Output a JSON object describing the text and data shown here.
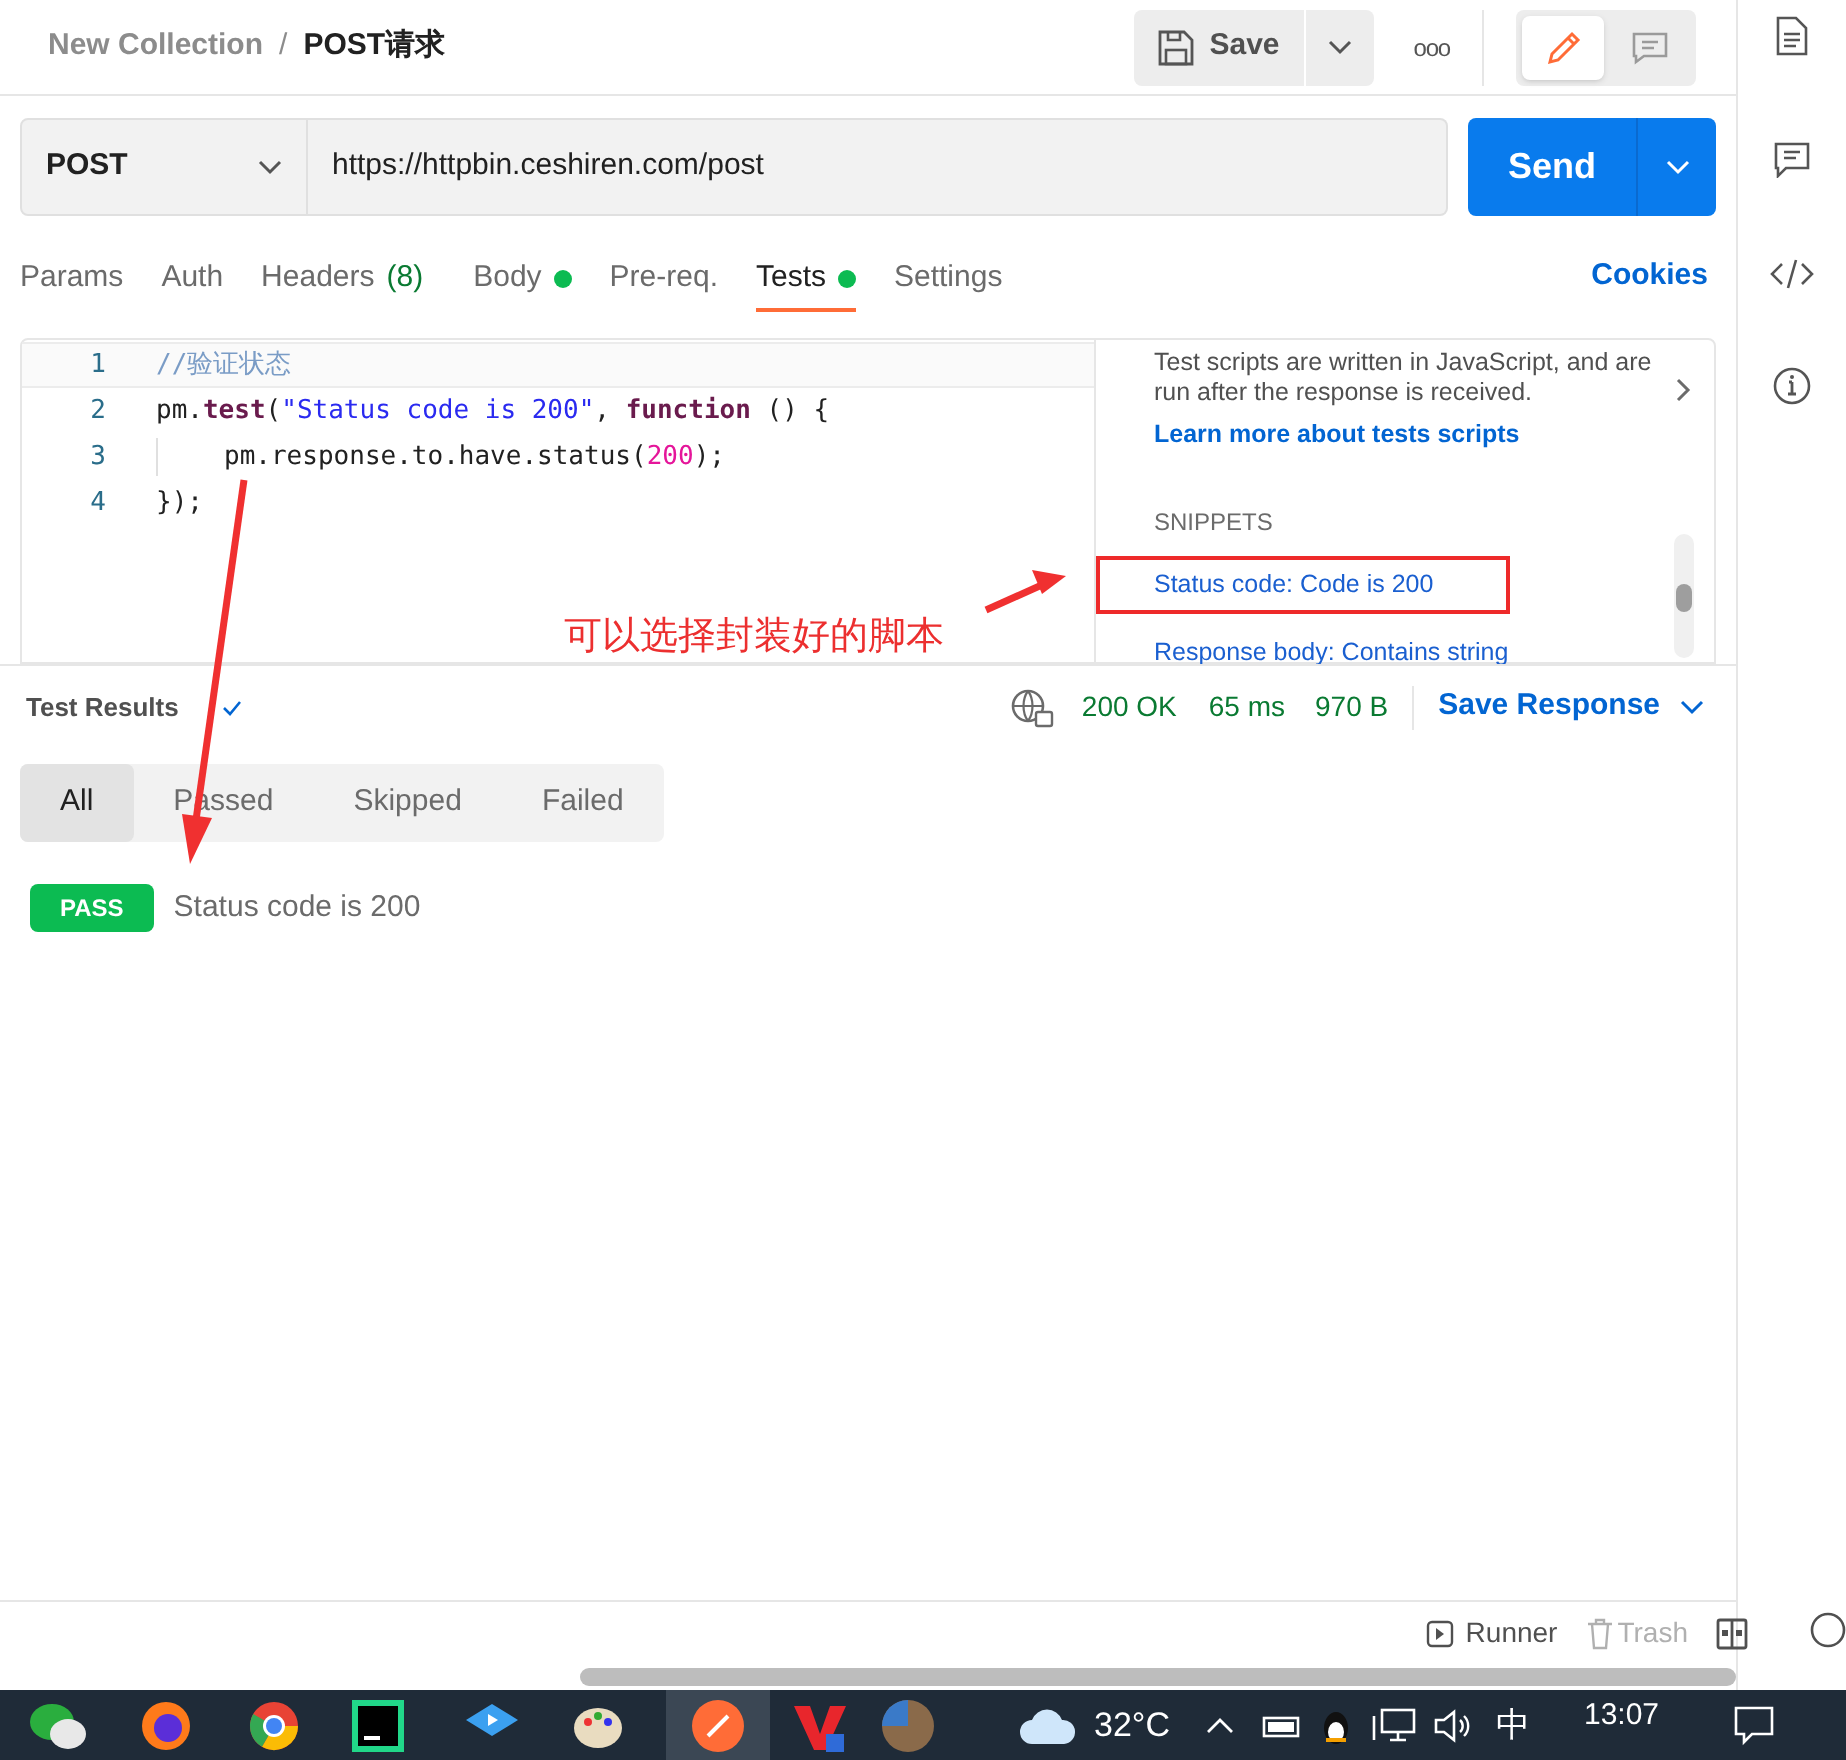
{
  "breadcrumb": {
    "collection": "New Collection",
    "separator": "/",
    "request": "POST请求"
  },
  "toolbar": {
    "save": "Save",
    "more": "ooo",
    "modes": [
      {
        "kind": "edit",
        "selected": true
      },
      {
        "kind": "comment",
        "selected": false
      }
    ]
  },
  "request": {
    "method": "POST",
    "url": "https://httpbin.ceshiren.com/post",
    "send": "Send"
  },
  "tabs": [
    {
      "label": "Params",
      "dot": false,
      "selected": false
    },
    {
      "label": "Auth",
      "dot": false,
      "selected": false
    },
    {
      "label": "Headers",
      "count": "(8)",
      "dot": false,
      "selected": false
    },
    {
      "label": "Body",
      "dot": true,
      "selected": false
    },
    {
      "label": "Pre-req.",
      "dot": false,
      "selected": false
    },
    {
      "label": "Tests",
      "dot": true,
      "selected": true
    },
    {
      "label": "Settings",
      "dot": false,
      "selected": false
    }
  ],
  "cookies": "Cookies",
  "editor": {
    "lines": [
      {
        "number": "1",
        "indent": false,
        "tokens": [
          {
            "text": "//验证状态",
            "kind": "comment"
          }
        ]
      },
      {
        "number": "2",
        "indent": false,
        "tokens": [
          {
            "text": "pm.",
            "kind": "plain"
          },
          {
            "text": "test",
            "kind": "keyword"
          },
          {
            "text": "(",
            "kind": "plain"
          },
          {
            "text": "\"Status code is 200\"",
            "kind": "string"
          },
          {
            "text": ", ",
            "kind": "plain"
          },
          {
            "text": "function",
            "kind": "keyword"
          },
          {
            "text": " () {",
            "kind": "plain"
          }
        ]
      },
      {
        "number": "3",
        "indent": true,
        "tokens": [
          {
            "text": "pm.response.to.have.status(",
            "kind": "plain"
          },
          {
            "text": "200",
            "kind": "number"
          },
          {
            "text": ");",
            "kind": "plain"
          }
        ]
      },
      {
        "number": "4",
        "indent": false,
        "tokens": [
          {
            "text": "});",
            "kind": "plain"
          }
        ]
      }
    ]
  },
  "side_panel": {
    "description": "Test scripts are written in JavaScript, and are run after the response is received.",
    "link": "Learn more about tests scripts",
    "heading": "SNIPPETS",
    "snippets": [
      {
        "label": "Status code: Code is 200",
        "highlighted": true
      },
      {
        "label": "Response body: Contains string",
        "highlighted": false
      }
    ]
  },
  "annotation": "可以选择封装好的脚本",
  "response": {
    "title": "Test Results",
    "status": "200 OK",
    "time": "65 ms",
    "size": "970 B",
    "save": "Save Response"
  },
  "filters": [
    {
      "label": "All",
      "selected": true
    },
    {
      "label": "Passed",
      "selected": false
    },
    {
      "label": "Skipped",
      "selected": false
    },
    {
      "label": "Failed",
      "selected": false
    }
  ],
  "results": [
    {
      "badge": "PASS",
      "name": "Status code is 200"
    }
  ],
  "status_bar": {
    "runner": "Runner",
    "trash": "Trash"
  },
  "taskbar": {
    "temperature": "32°C",
    "ime": "中",
    "time": "13:07"
  }
}
